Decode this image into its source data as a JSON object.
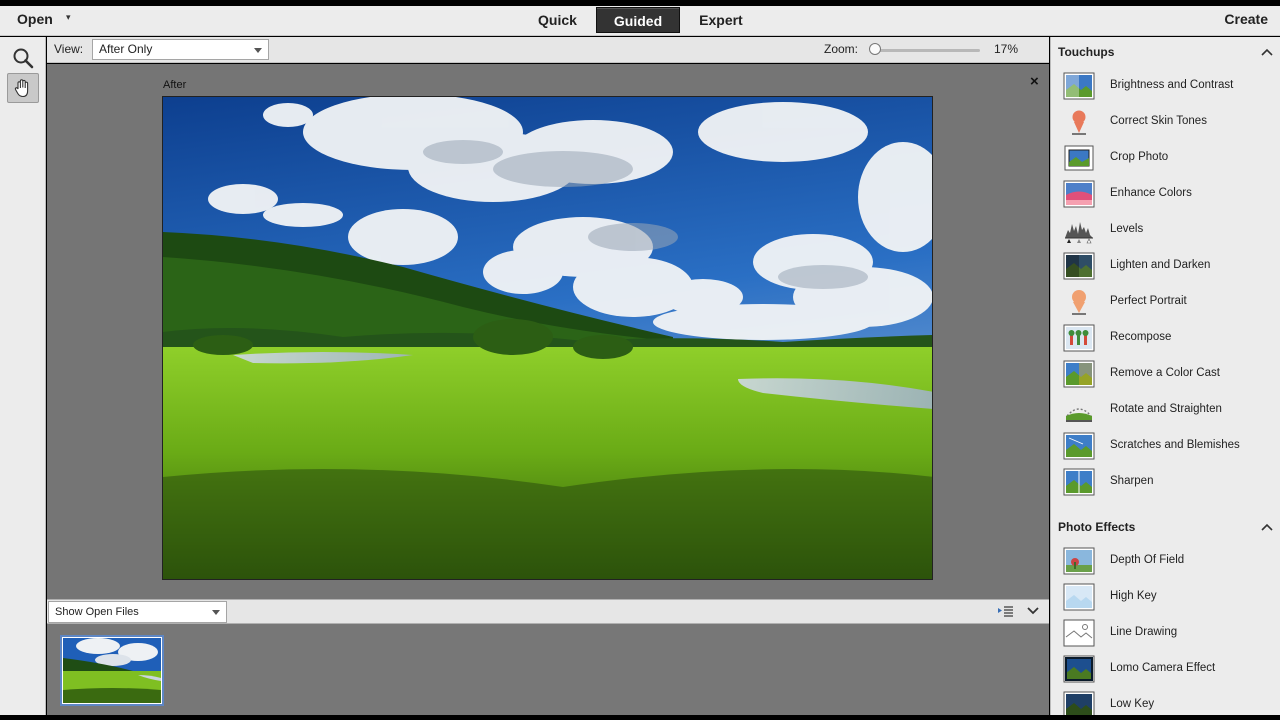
{
  "menubar": {
    "open_label": "Open",
    "modes": [
      {
        "label": "Quick",
        "active": false
      },
      {
        "label": "Guided",
        "active": true
      },
      {
        "label": "Expert",
        "active": false
      }
    ],
    "create_label": "Create"
  },
  "tools": [
    {
      "name": "zoom-tool",
      "icon": "magnifier-icon",
      "active": false
    },
    {
      "name": "hand-tool",
      "icon": "hand-icon",
      "active": true
    }
  ],
  "options": {
    "view_label": "View:",
    "view_value": "After Only",
    "zoom_label": "Zoom:",
    "zoom_value": "17%",
    "zoom_fraction": 0.17
  },
  "canvas": {
    "after_label": "After",
    "close_symbol": "×"
  },
  "bin": {
    "select_value": "Show Open Files"
  },
  "panel": {
    "touchups_title": "Touchups",
    "touchups": [
      {
        "label": "Brightness and Contrast",
        "icon": "brightness-contrast-icon"
      },
      {
        "label": "Correct Skin Tones",
        "icon": "skin-tone-icon"
      },
      {
        "label": "Crop Photo",
        "icon": "crop-icon"
      },
      {
        "label": "Enhance Colors",
        "icon": "enhance-colors-icon"
      },
      {
        "label": "Levels",
        "icon": "levels-icon"
      },
      {
        "label": "Lighten and Darken",
        "icon": "lighten-darken-icon"
      },
      {
        "label": "Perfect Portrait",
        "icon": "portrait-icon"
      },
      {
        "label": "Recompose",
        "icon": "recompose-icon"
      },
      {
        "label": "Remove a Color Cast",
        "icon": "color-cast-icon"
      },
      {
        "label": "Rotate and Straighten",
        "icon": "rotate-straighten-icon"
      },
      {
        "label": "Scratches and Blemishes",
        "icon": "scratches-icon"
      },
      {
        "label": "Sharpen",
        "icon": "sharpen-icon"
      }
    ],
    "effects_title": "Photo Effects",
    "effects": [
      {
        "label": "Depth Of Field",
        "icon": "depth-of-field-icon"
      },
      {
        "label": "High Key",
        "icon": "high-key-icon"
      },
      {
        "label": "Line Drawing",
        "icon": "line-drawing-icon"
      },
      {
        "label": "Lomo Camera Effect",
        "icon": "lomo-camera-icon"
      },
      {
        "label": "Low Key",
        "icon": "low-key-icon"
      }
    ]
  },
  "colors": {
    "active_tab": "#333333",
    "thumb_border": "#5d86c4",
    "canvas_bg": "#757575"
  }
}
